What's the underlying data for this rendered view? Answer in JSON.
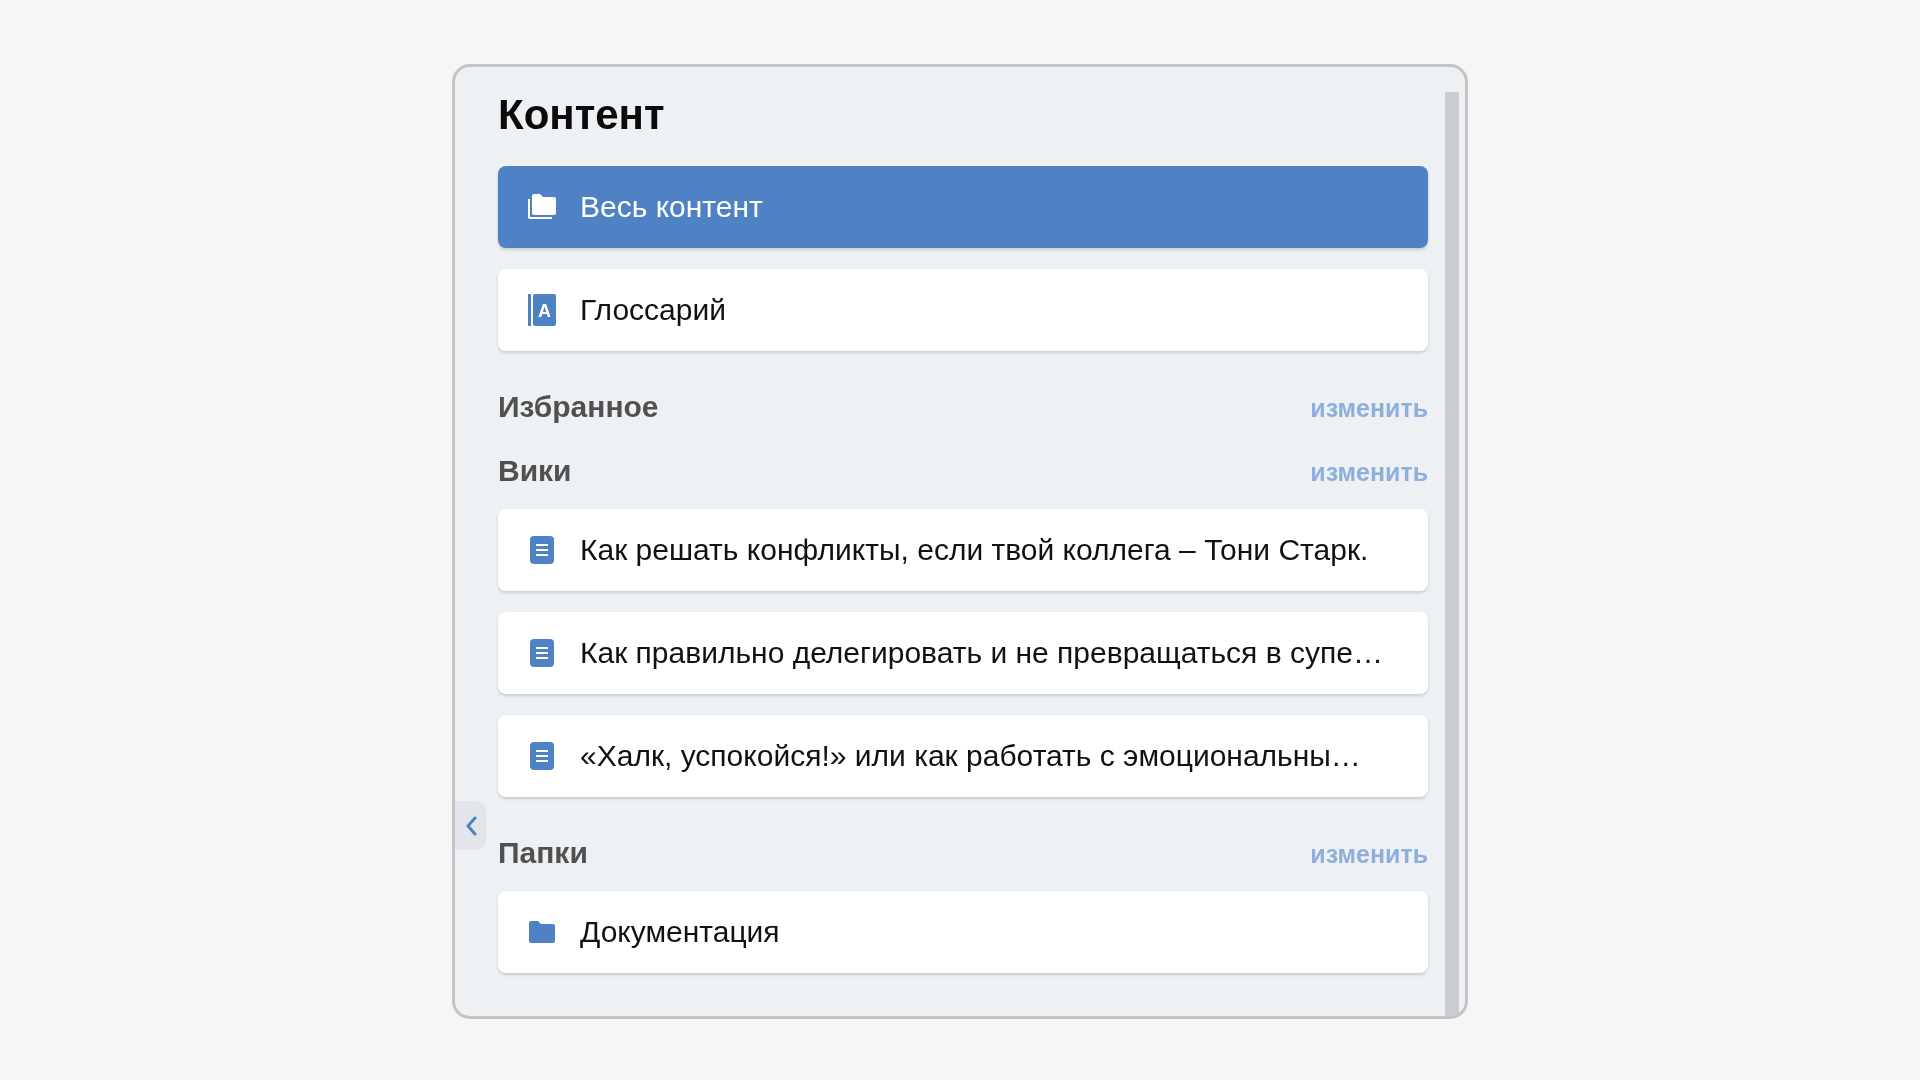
{
  "panel": {
    "title": "Контент",
    "items": [
      {
        "kind": "folders",
        "label": "Весь контент",
        "selected": true
      },
      {
        "kind": "glossary",
        "icon_letter": "A",
        "label": "Глоссарий",
        "selected": false
      }
    ],
    "sections": [
      {
        "title": "Избранное",
        "action": "изменить"
      },
      {
        "title": "Вики",
        "action": "изменить",
        "items": [
          {
            "kind": "doc",
            "label": "Как решать конфликты, если твой коллега – Тони Старк.",
            "selected": false
          },
          {
            "kind": "doc",
            "label": "Как правильно делегировать и не превращаться в супе…",
            "selected": false
          },
          {
            "kind": "doc",
            "label": "«Халк, успокойся!» или как работать с эмоциональны…",
            "selected": false
          }
        ]
      },
      {
        "title": "Папки",
        "action": "изменить",
        "items": [
          {
            "kind": "folder",
            "label": "Документация",
            "selected": false
          }
        ]
      }
    ]
  }
}
